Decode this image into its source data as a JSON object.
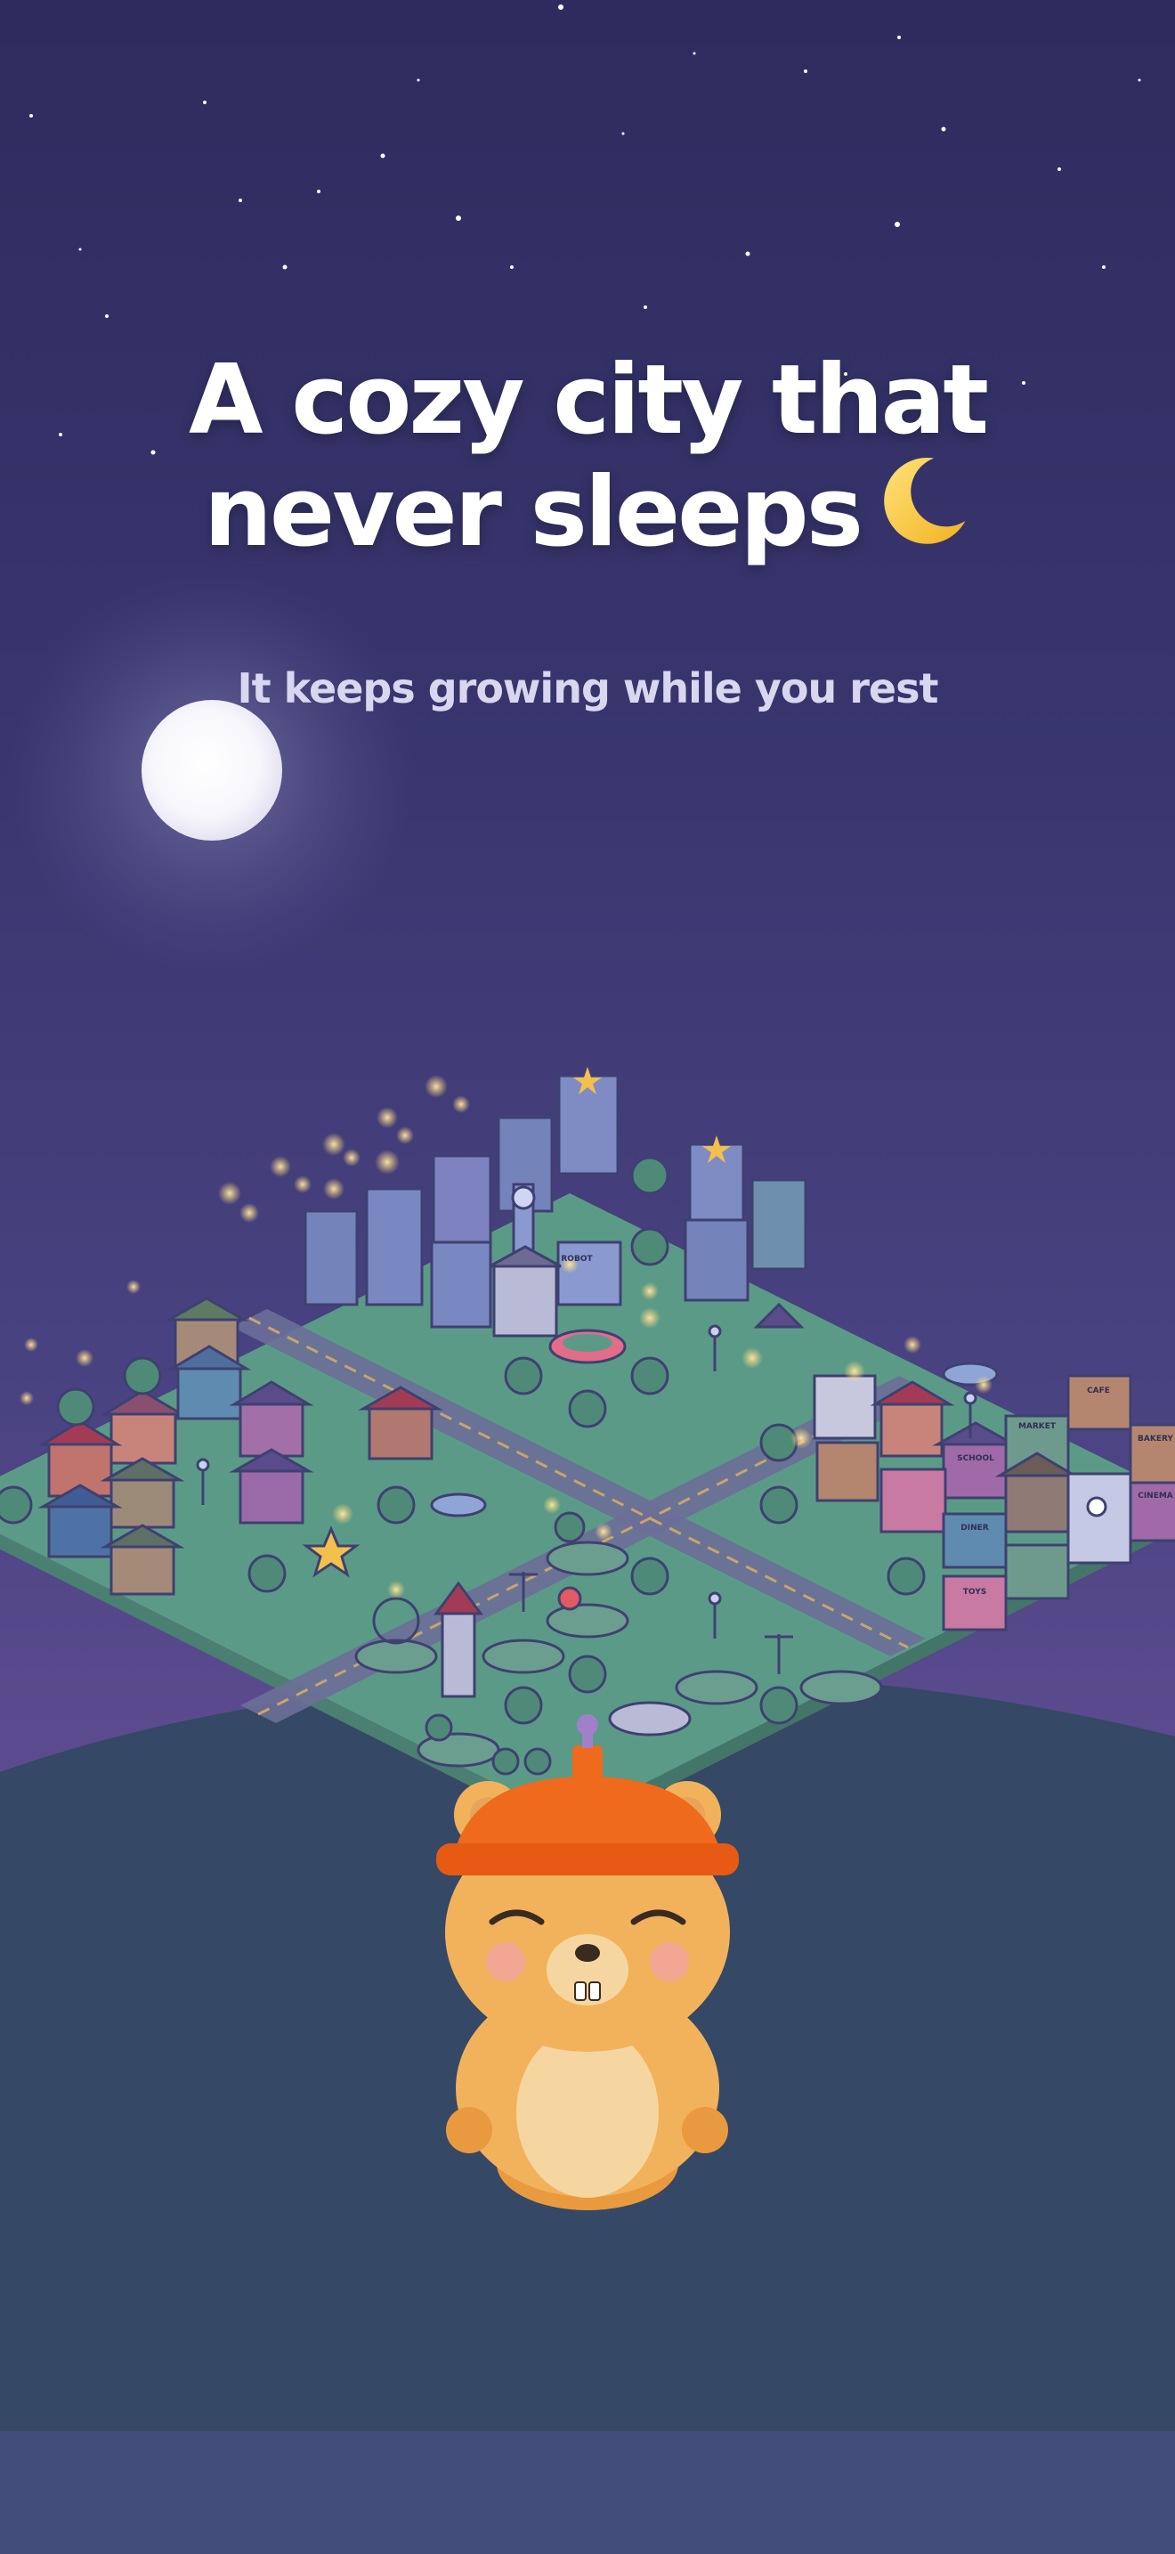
{
  "headline": {
    "line1": "A cozy city that",
    "line2": "never sleeps",
    "emoji": "crescent-moon-icon"
  },
  "subtitle": "It keeps growing while you rest",
  "colors": {
    "sky_top": "#2e2c5e",
    "sky_bottom": "#5e4d8c",
    "hill": "#354865",
    "ground": "#5c9a88",
    "road": "#6a6f96",
    "bear": "#f0b15a",
    "hat": "#ef6a1c",
    "footer": "#424c7a"
  },
  "illustration": {
    "moon": "full-moon",
    "city": "isometric-city",
    "character": "sleeping-bear-with-beanie",
    "sign_labels": [
      "ROBOT",
      "CAFE",
      "MARKET",
      "BAKERY",
      "SCHOOL",
      "TOYS",
      "DINER",
      "CINEMA"
    ]
  }
}
